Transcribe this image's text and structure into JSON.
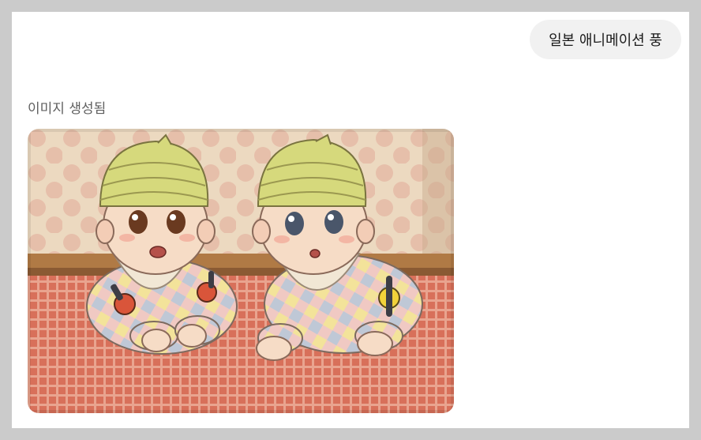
{
  "conversation": {
    "user_message": "일본 애니메이션 풍",
    "assistant": {
      "status": "이미지 생성됨",
      "image": {
        "subject": "anime-style illustration",
        "colors": {
          "wallpaper": "#ead8bf",
          "wallpaper_dots": "#e6b8a8",
          "rug": "#d86a55",
          "hat": "#d2d67a",
          "skin": "#f6dcc6"
        }
      }
    }
  }
}
